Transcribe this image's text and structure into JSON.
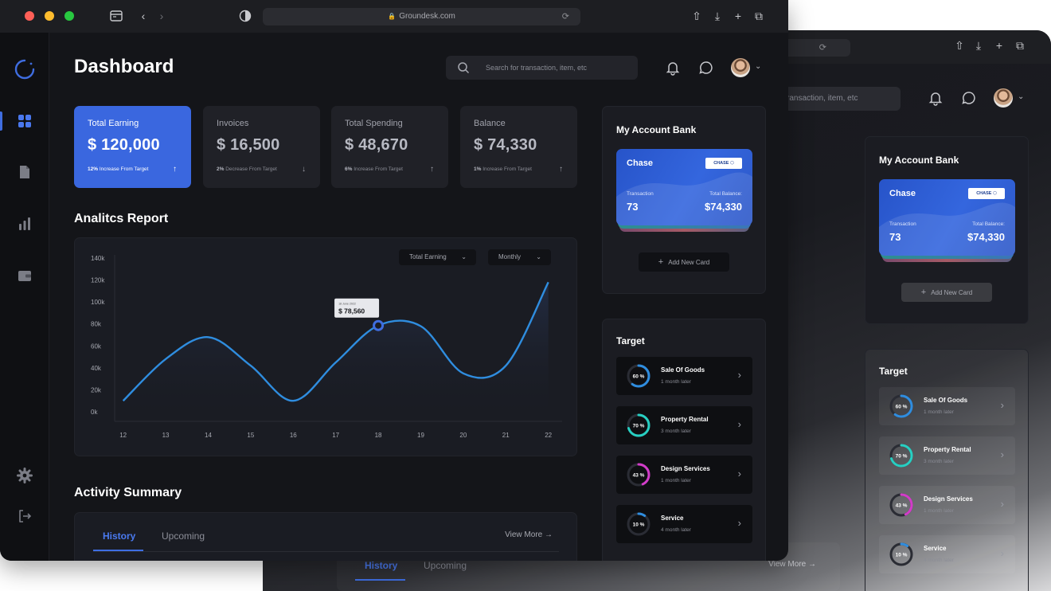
{
  "browser": {
    "url": "Groundesk.com"
  },
  "header": {
    "title": "Dashboard",
    "search_placeholder": "Search for transaction, item, etc",
    "search_placeholder_partial": "ransaction, item, etc"
  },
  "stats": [
    {
      "label": "Total Earning",
      "value": "$ 120,000",
      "pct": "12%",
      "note": "Increase From Target",
      "trend": "up"
    },
    {
      "label": "Invoices",
      "value": "$ 16,500",
      "pct": "2%",
      "note": "Decrease From Target",
      "trend": "down"
    },
    {
      "label": "Total Spending",
      "value": "$ 48,670",
      "pct": "6%",
      "note": "Increase From Target",
      "trend": "up"
    },
    {
      "label": "Balance",
      "value": "$ 74,330",
      "pct": "1%",
      "note": "Increase From Target",
      "trend": "up"
    }
  ],
  "analytics": {
    "title": "Analitcs Report",
    "dropdown_metric": "Total Earning",
    "dropdown_period": "Monthly",
    "tooltip_date": "18 June 2022",
    "tooltip_value": "$ 78,560"
  },
  "chart_data": {
    "type": "line",
    "x": [
      12,
      13,
      14,
      15,
      16,
      17,
      18,
      19,
      20,
      21,
      22
    ],
    "x_tick_labels": [
      "12",
      "13",
      "14",
      "15",
      "16",
      "17",
      "18",
      "19",
      "20",
      "21",
      "22"
    ],
    "y_tick_labels": [
      "0k",
      "20k",
      "40k",
      "60k",
      "80k",
      "100k",
      "120k",
      "140k"
    ],
    "y_ticks": [
      0,
      20000,
      40000,
      60000,
      80000,
      100000,
      120000,
      140000
    ],
    "values": [
      10000,
      48000,
      68000,
      42000,
      10000,
      45000,
      78560,
      78000,
      35000,
      42000,
      118000
    ],
    "ylim": [
      0,
      140000
    ],
    "xlim": [
      11.8,
      22.1
    ],
    "highlight_index": 6,
    "color": "#2f8ddf",
    "grid": false
  },
  "activity": {
    "title": "Activity Summary",
    "tabs": [
      "History",
      "Upcoming"
    ],
    "view_more": "View More"
  },
  "bank": {
    "title": "My Account Bank",
    "card_name": "Chase",
    "card_logo": "CHASE",
    "transaction_label": "Transaction",
    "transaction_value": "73",
    "balance_label": "Total Balance:",
    "balance_value": "$74,330",
    "add_card": "Add New Card"
  },
  "target": {
    "title": "Target",
    "items": [
      {
        "name": "Sale Of Goods",
        "sub": "1 month later",
        "pct_label": "60 %",
        "pct": 0.6,
        "color": "#2f8ddf"
      },
      {
        "name": "Property Rental",
        "sub": "3 month later",
        "pct_label": "70 %",
        "pct": 0.7,
        "color": "#27cfc2"
      },
      {
        "name": "Design Services",
        "sub": "1 month later",
        "pct_label": "43 %",
        "pct": 0.43,
        "color": "#d23cc9"
      },
      {
        "name": "Service",
        "sub": "4 month later",
        "pct_label": "10 %",
        "pct": 0.1,
        "color": "#2f8ddf"
      }
    ]
  },
  "back_window": {
    "stat_digit": "0",
    "stat_note_fragment": "get",
    "axis_tick": "22"
  },
  "colors": {
    "accent": "#3a67df",
    "background": "#141519",
    "card": "#202127"
  }
}
